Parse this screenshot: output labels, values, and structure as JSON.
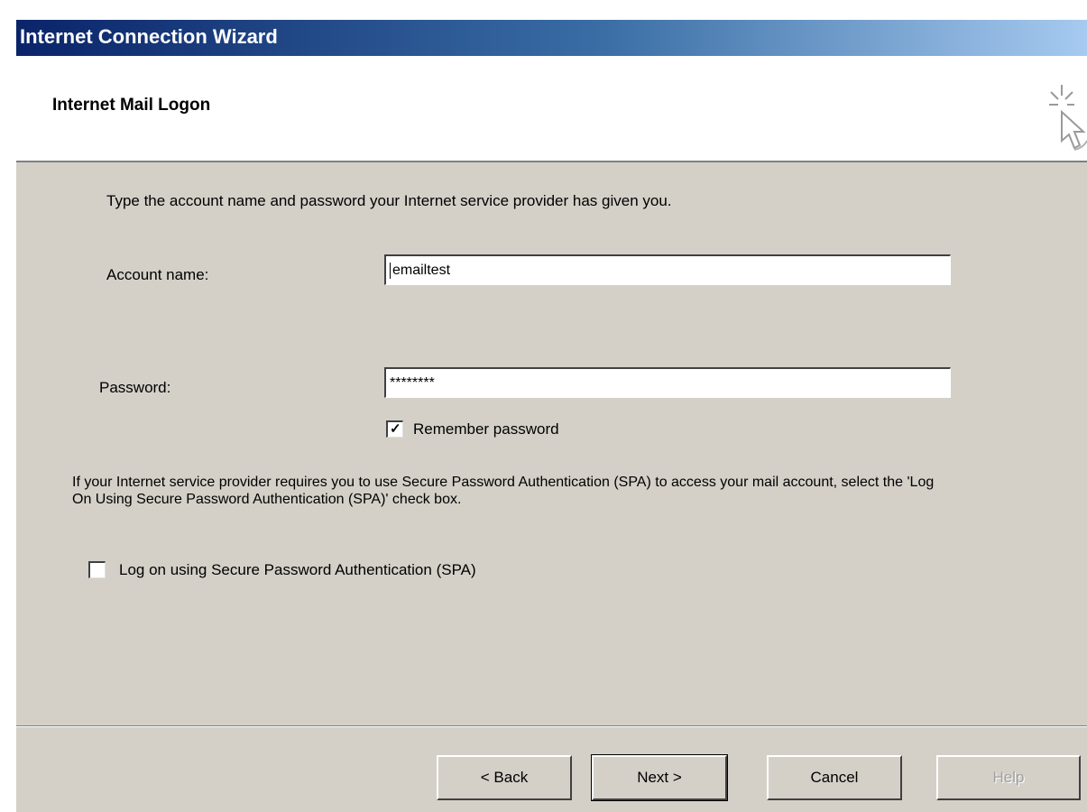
{
  "window": {
    "title": "Internet Connection Wizard"
  },
  "header": {
    "heading": "Internet Mail Logon"
  },
  "content": {
    "intro": "Type the account name and password your Internet service provider has given you.",
    "account_label": "Account name:",
    "account_value": "emailtest",
    "password_label": "Password:",
    "password_value": "********",
    "remember_label": "Remember password",
    "remember_checked": true,
    "spa_description": "If your Internet service provider requires you to use Secure Password Authentication (SPA) to access your mail account, select the 'Log On Using Secure Password Authentication (SPA)' check box.",
    "spa_label": "Log on using Secure Password Authentication (SPA)",
    "spa_checked": false
  },
  "buttons": {
    "back": "< Back",
    "next": "Next >",
    "cancel": "Cancel",
    "help": "Help"
  },
  "colors": {
    "title_bar": "#0a246a",
    "dialog_bg": "#d4d0c8",
    "header_bg": "#ffffff"
  },
  "icons": {
    "wizard": "wizard-cursor-icon",
    "check": "check-icon"
  }
}
